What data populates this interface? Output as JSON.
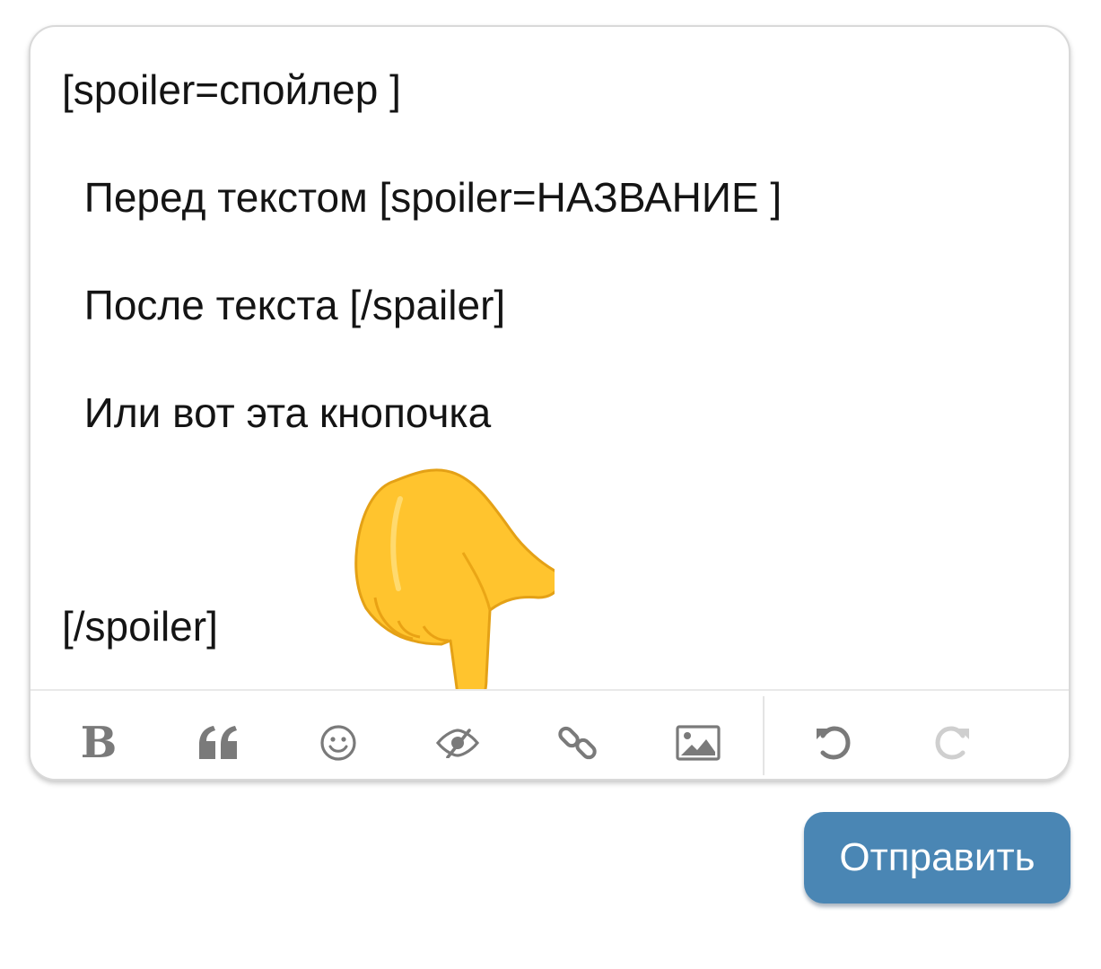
{
  "editor": {
    "lines": [
      "[spoiler=спойлер ]",
      " Перед текстом [spoiler=НАЗВАНИЕ ]",
      " После текста [/spailer]",
      " Или вот эта кнопочка",
      "[/spoiler]"
    ]
  },
  "toolbar": {
    "bold_glyph": "B",
    "buttons": [
      {
        "icon": "bold-icon"
      },
      {
        "icon": "quote-icon"
      },
      {
        "icon": "smiley-icon"
      },
      {
        "icon": "spoiler-eye-slash-icon"
      },
      {
        "icon": "link-icon"
      },
      {
        "icon": "image-icon"
      },
      {
        "icon": "undo-icon"
      },
      {
        "icon": "redo-icon"
      }
    ]
  },
  "send_button": {
    "label": "Отправить"
  },
  "colors": {
    "toolbar_icon": "#7a7a7a",
    "toolbar_icon_disabled": "#cfcfcf",
    "send_button_bg": "#4a86b4",
    "pointing_hand": "#ffc42e"
  }
}
